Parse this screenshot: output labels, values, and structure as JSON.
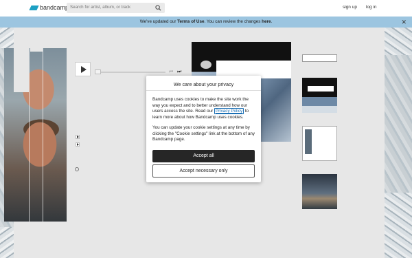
{
  "header": {
    "logo_text": "bandcamp",
    "search_placeholder": "Search for artist, album, or track",
    "sign_up": "sign up",
    "log_in": "log in"
  },
  "notice": {
    "prefix": "We've updated our ",
    "terms": "Terms of Use",
    "middle": ". You can review the changes ",
    "here": "here",
    "suffix": "."
  },
  "modal": {
    "title": "We care about your privacy",
    "p1_before": "Bandcamp uses cookies to make the site work the way you expect and to better understand how our users access the site. Read our ",
    "privacy_link": "Privacy Policy",
    "p1_after": " to learn more about how Bandcamp uses cookies.",
    "p2": "You can update your cookie settings at any time by clicking the \"Cookie settings\" link at the bottom of any Bandcamp page.",
    "accept_all": "Accept all",
    "accept_necessary": "Accept necessary only"
  },
  "icons": {
    "search": "search-icon",
    "close": "close-icon",
    "play": "play-icon"
  },
  "colors": {
    "brand": "#1da0c3",
    "notice_bg": "#9cc5e0",
    "primary_button": "#262626"
  }
}
